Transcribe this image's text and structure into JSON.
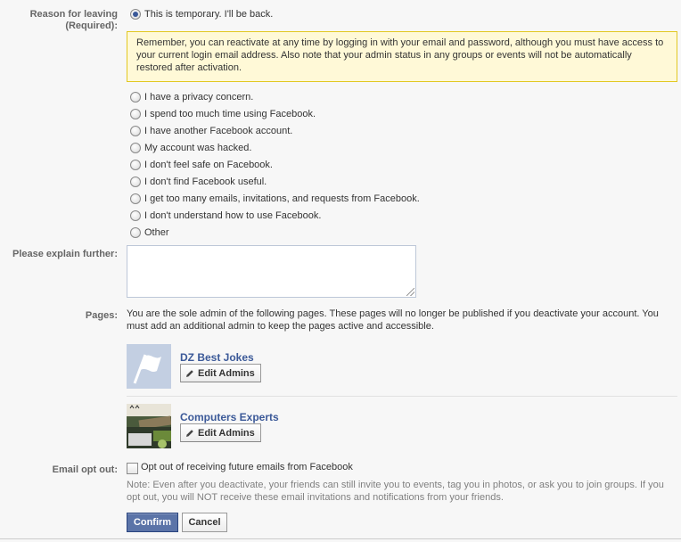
{
  "reason": {
    "label_line1": "Reason for leaving",
    "label_line2": "(Required):",
    "selected_option": "This is temporary. I'll be back.",
    "notice": "Remember, you can reactivate at any time by logging in with your email and password, although you must have access to your current login email address. Also note that your admin status in any groups or events will not be automatically restored after activation.",
    "options": [
      "I have a privacy concern.",
      "I spend too much time using Facebook.",
      "I have another Facebook account.",
      "My account was hacked.",
      "I don't feel safe on Facebook.",
      "I don't find Facebook useful.",
      "I get too many emails, invitations, and requests from Facebook.",
      "I don't understand how to use Facebook.",
      "Other"
    ]
  },
  "explain": {
    "label": "Please explain further:",
    "value": ""
  },
  "pages": {
    "label": "Pages:",
    "description": "You are the sole admin of the following pages. These pages will no longer be published if you deactivate your account. You must add an additional admin to keep the pages active and accessible.",
    "items": [
      {
        "name": "DZ Best Jokes",
        "button": "Edit Admins",
        "thumb_icon": "flag-icon"
      },
      {
        "name": "Computers Experts",
        "button": "Edit Admins",
        "thumb_icon": "page-photo"
      }
    ]
  },
  "email_opt_out": {
    "label": "Email opt out:",
    "checkbox_label": "Opt out of receiving future emails from Facebook",
    "checked": false,
    "note": "Note: Even after you deactivate, your friends can still invite you to events, tag you in photos, or ask you to join groups. If you opt out, you will NOT receive these email invitations and notifications from your friends."
  },
  "actions": {
    "confirm": "Confirm",
    "cancel": "Cancel"
  },
  "colors": {
    "brand": "#3b5998",
    "notice_bg": "#fff9d7",
    "notice_border": "#e2c822",
    "label": "#666666",
    "page_bg": "#f7f7f7"
  }
}
